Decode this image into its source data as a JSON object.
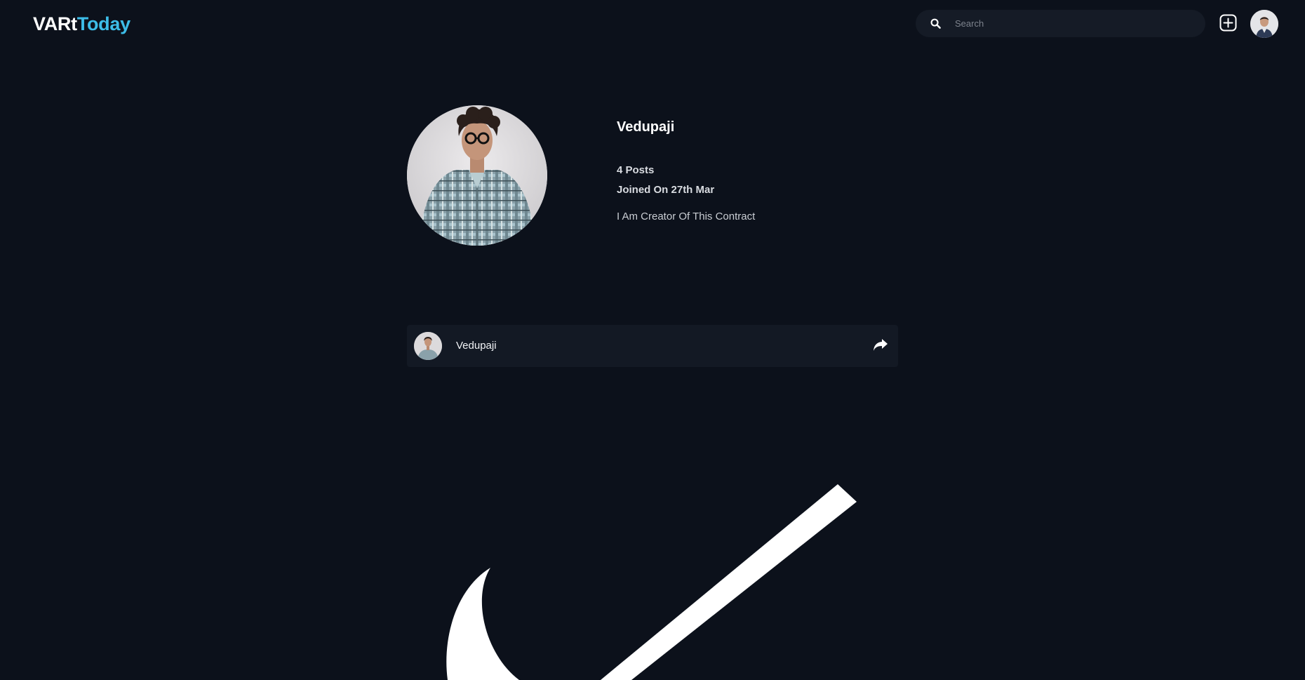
{
  "header": {
    "logo_part1": "VARt",
    "logo_part2": "Today",
    "search_placeholder": "Search",
    "icons": [
      "search-icon",
      "add-icon",
      "avatar"
    ]
  },
  "profile": {
    "name": "Vedupaji",
    "posts": "4 Posts",
    "joined": "Joined On 27th Mar",
    "bio": "I Am Creator Of This Contract"
  },
  "post": {
    "author": "Vedupaji",
    "icons": [
      "share-icon"
    ]
  },
  "colors": {
    "background": "#0c111b",
    "accent": "#3dbde8",
    "card": "#131924",
    "search_bg": "#151b26"
  }
}
